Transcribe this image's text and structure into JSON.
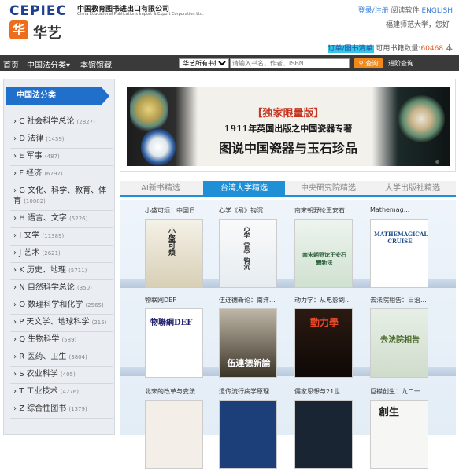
{
  "header": {
    "logo_text": "CEPIEC",
    "company_cn": "中国教育图书进出口有限公司",
    "company_en": "China Educational Publications Import & Export Corporation Ltd.",
    "brand_badge": "华",
    "brand_name": "华艺",
    "login_link": "登录/注册",
    "reader_link": "阅读软件",
    "lang_link": "ENGLISH",
    "welcome": "福建师范大学，您好",
    "cart_highlight": "订单/图书清单",
    "cart_label": "可用书籍数量:",
    "cart_count": "60468",
    "cart_suffix": "本"
  },
  "nav": {
    "home": "首页",
    "category": "中国法分类",
    "library": "本馆馆藏",
    "scope_option": "华艺所有书籍",
    "search_placeholder": "请输入书名、作者、ISBN...",
    "search_button": "查询",
    "advanced": "进阶查询"
  },
  "sidebar": {
    "title": "中国法分类",
    "items": [
      {
        "label": "C 社会科学总论",
        "count": "(2827)"
      },
      {
        "label": "D 法律",
        "count": "(1439)"
      },
      {
        "label": "E 军事",
        "count": "(487)"
      },
      {
        "label": "F 经济",
        "count": "(6797)"
      },
      {
        "label": "G 文化、科学、教育、体育",
        "count": "(10082)"
      },
      {
        "label": "H 语言、文字",
        "count": "(5226)"
      },
      {
        "label": "I 文学",
        "count": "(11389)"
      },
      {
        "label": "J 艺术",
        "count": "(2621)"
      },
      {
        "label": "K 历史、地理",
        "count": "(5711)"
      },
      {
        "label": "N 自然科学总论",
        "count": "(350)"
      },
      {
        "label": "O 数理科学和化学",
        "count": "(2565)"
      },
      {
        "label": "P 天文学、地球科学",
        "count": "(215)"
      },
      {
        "label": "Q 生物科学",
        "count": "(589)"
      },
      {
        "label": "R 医药、卫生",
        "count": "(3804)"
      },
      {
        "label": "S 农业科学",
        "count": "(405)"
      },
      {
        "label": "T 工业技术",
        "count": "(4276)"
      },
      {
        "label": "Z 综合性图书",
        "count": "(1379)"
      }
    ]
  },
  "banner": {
    "line1": "【独家限量版】",
    "line2": "1911年英国出版之中国瓷器专著",
    "line3": "图说中国瓷器与玉石珍品"
  },
  "tabs": [
    {
      "label": "AI新书精选"
    },
    {
      "label": "台湾大学精选"
    },
    {
      "label": "中央研究院精选"
    },
    {
      "label": "大学出版社精选"
    }
  ],
  "books": [
    {
      "title": "小盛可烦：中国日...",
      "cover_text": "小盛可烦"
    },
    {
      "title": "心学《易》钩沉",
      "cover_text": "心学《易》钩沉"
    },
    {
      "title": "南宋朝野论王安石...",
      "cover_text": "南宋朝野论王安石變新法"
    },
    {
      "title": "Mathemag...",
      "cover_text": "MATHEMAGICAL CRUISE"
    },
    {
      "title": "物联网DEF",
      "cover_text": "物聯網DEF"
    },
    {
      "title": "伍连德新论：南洋...",
      "cover_text": "伍連德新論"
    },
    {
      "title": "动力学：从电影到...",
      "cover_text": "動力學"
    },
    {
      "title": "去法院相告：日治...",
      "cover_text": "去法院相告"
    },
    {
      "title": "北宋的改革与变法...",
      "cover_text": ""
    },
    {
      "title": "遗传流行病学原理",
      "cover_text": ""
    },
    {
      "title": "儒家思想与21世...",
      "cover_text": ""
    },
    {
      "title": "巨襟创生：九二一...",
      "cover_text": "創生"
    }
  ],
  "colors": {
    "nav_bg": "#3a3a3a",
    "accent_blue": "#1f8fd6",
    "search_btn": "#f08a1c"
  }
}
